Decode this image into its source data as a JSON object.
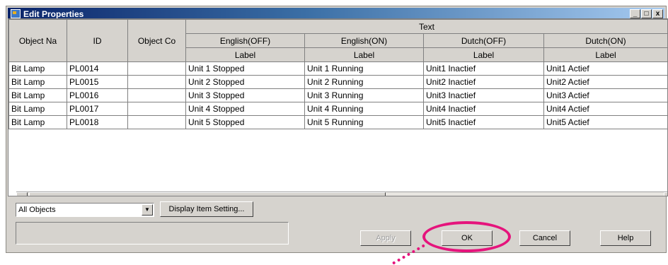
{
  "window": {
    "title": "Edit Properties",
    "minimize_glyph": "_",
    "maximize_glyph": "□",
    "close_glyph": "x"
  },
  "table": {
    "header_row1": {
      "object_name": "Object Na",
      "id": "ID",
      "object_comment": "Object Co",
      "text_group": "Text"
    },
    "language_columns": [
      "English(OFF)",
      "English(ON)",
      "Dutch(OFF)",
      "Dutch(ON)"
    ],
    "sub_label": "Label",
    "rows": [
      [
        "Bit Lamp",
        "PL0014",
        "",
        "Unit 1 Stopped",
        "Unit 1 Running",
        "Unit1 Inactief",
        "Unit1 Actief"
      ],
      [
        "Bit Lamp",
        "PL0015",
        "",
        "Unit 2 Stopped",
        "Unit 2 Running",
        "Unit2 Inactief",
        "Unit2 Actief"
      ],
      [
        "Bit Lamp",
        "PL0016",
        "",
        "Unit 3 Stopped",
        "Unit 3 Running",
        "Unit3 Inactief",
        "Unit3 Actief"
      ],
      [
        "Bit Lamp",
        "PL0017",
        "",
        "Unit 4 Stopped",
        "Unit 4 Running",
        "Unit4 Inactief",
        "Unit4 Actief"
      ],
      [
        "Bit Lamp",
        "PL0018",
        "",
        "Unit 5 Stopped",
        "Unit 5 Running",
        "Unit5 Inactief",
        "Unit5 Actief"
      ]
    ]
  },
  "scroll": {
    "left_glyph": "◀",
    "right_glyph": "▶"
  },
  "filter": {
    "selected": "All Objects",
    "arrow_glyph": "▼"
  },
  "buttons": {
    "display_item": "Display Item Setting...",
    "apply": "Apply",
    "ok": "OK",
    "cancel": "Cancel",
    "help": "Help"
  },
  "colors": {
    "highlight": "#e5147c",
    "titlebar_start": "#0a246a",
    "titlebar_end": "#a6caf0"
  }
}
